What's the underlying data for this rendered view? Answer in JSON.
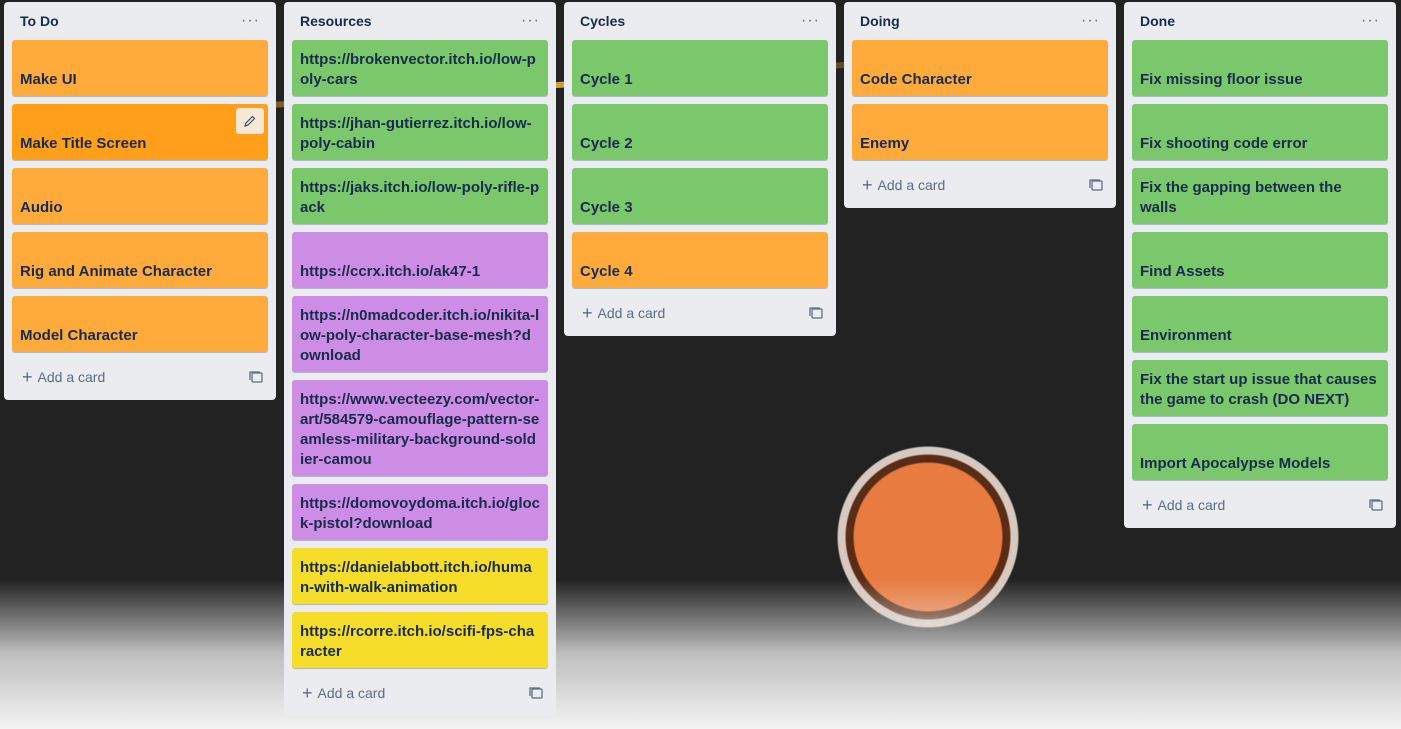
{
  "board": {
    "lists": [
      {
        "title": "To Do",
        "menu_label": "···",
        "add_card_label": "Add a card",
        "cards": [
          {
            "text": "Make UI"
          },
          {
            "text": "Make Title Screen"
          },
          {
            "text": "Audio"
          },
          {
            "text": "Rig and Animate Character"
          },
          {
            "text": "Model Character"
          }
        ]
      },
      {
        "title": "Resources",
        "menu_label": "···",
        "add_card_label": "Add a card",
        "cards": [
          {
            "text": "https://brokenvector.itch.io/low-poly-cars"
          },
          {
            "text": "https://jhan-gutierrez.itch.io/low-poly-cabin"
          },
          {
            "text": "https://jaks.itch.io/low-poly-rifle-pack"
          },
          {
            "text": "https://ccrx.itch.io/ak47-1"
          },
          {
            "text": "https://n0madcoder.itch.io/nikita-low-poly-character-base-mesh?download"
          },
          {
            "text": "https://www.vecteezy.com/vector-art/584579-camouflage-pattern-seamless-military-background-soldier-camou"
          },
          {
            "text": "https://domovoydoma.itch.io/glock-pistol?download"
          },
          {
            "text": "https://danielabbott.itch.io/human-with-walk-animation"
          },
          {
            "text": "https://rcorre.itch.io/scifi-fps-character"
          }
        ]
      },
      {
        "title": "Cycles",
        "menu_label": "···",
        "add_card_label": "Add a card",
        "cards": [
          {
            "text": "Cycle 1"
          },
          {
            "text": "Cycle 2"
          },
          {
            "text": "Cycle 3"
          },
          {
            "text": "Cycle 4"
          }
        ]
      },
      {
        "title": "Doing",
        "menu_label": "···",
        "add_card_label": "Add a card",
        "cards": [
          {
            "text": "Code Character"
          },
          {
            "text": "Enemy"
          }
        ]
      },
      {
        "title": "Done",
        "menu_label": "···",
        "add_card_label": "Add a card",
        "cards": [
          {
            "text": "Fix missing floor issue"
          },
          {
            "text": "Fix shooting code error"
          },
          {
            "text": "Fix the gapping between the walls"
          },
          {
            "text": "Find Assets"
          },
          {
            "text": "Environment"
          },
          {
            "text": "Fix the start up issue that causes the game to crash (DO NEXT)"
          },
          {
            "text": "Import Apocalypse Models"
          }
        ]
      }
    ]
  },
  "colors": {
    "orange_label": "#ffab3c",
    "green_label": "#7bc86c",
    "purple_label": "#cd8de5",
    "yellow_label": "#f5dd29",
    "list_bg": "#ebecf0"
  },
  "icons": {
    "card_edit": "pencil-icon",
    "add": "plus-icon",
    "template": "card-template-icon",
    "list_menu": "more-icon"
  }
}
